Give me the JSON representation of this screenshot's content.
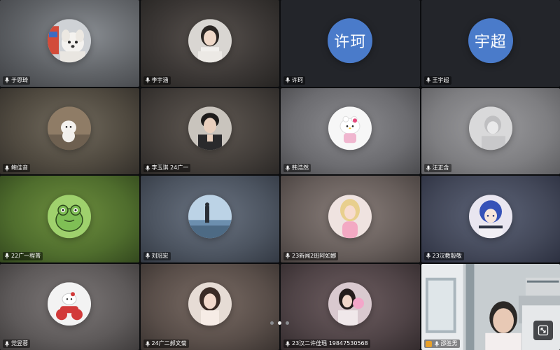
{
  "pager": {
    "pages": 3,
    "active": 1
  },
  "tiles": [
    {
      "name": "于恩琦",
      "avatar": "puppy-in-box",
      "bg": "#6d6d73"
    },
    {
      "name": "李宇涵",
      "avatar": "girl-photo",
      "bg": "#3f3b38"
    },
    {
      "name": "许珂",
      "avatar_text": "许珂",
      "bg": "#24262a",
      "avatar_color": "#4778c9"
    },
    {
      "name": "王宇超",
      "avatar_text": "宇超",
      "bg": "#24262a",
      "avatar_color": "#4778c9"
    },
    {
      "name": "鲍佳音",
      "avatar": "white-dog",
      "bg": "#565044"
    },
    {
      "name": "李玉琪 24广一",
      "avatar": "boy-photo",
      "bg": "#4a4541"
    },
    {
      "name": "韩浩然",
      "avatar": "hello-kitty",
      "bg": "#7a7a7e"
    },
    {
      "name": "汪正含",
      "avatar": "pale-figure",
      "bg": "#8a8a8d"
    },
    {
      "name": "22广一程菁",
      "avatar": "green-frog",
      "bg": "#4a6d33"
    },
    {
      "name": "刘冠宏",
      "avatar": "landscape-person",
      "bg": "#4f5560"
    },
    {
      "name": "23新闻2班阿如娜",
      "avatar": "doll",
      "bg": "#6f6562"
    },
    {
      "name": "23汉教殷敬",
      "avatar": "anime-girl",
      "bg": "#3e4352"
    },
    {
      "name": "党昱蓉",
      "avatar": "kitty-bike",
      "bg": "#5e5c5c"
    },
    {
      "name": "24广二郝文菊",
      "avatar": "girl-portrait",
      "bg": "#5a4f4a"
    },
    {
      "name": "23汉二许佳瑶 19847530568",
      "avatar": "girl-balloon",
      "bg": "#4a3f42"
    },
    {
      "name": "邵胜男",
      "avatar": "camera-video",
      "bg": "#b8c0c4",
      "camera_on": true
    }
  ]
}
